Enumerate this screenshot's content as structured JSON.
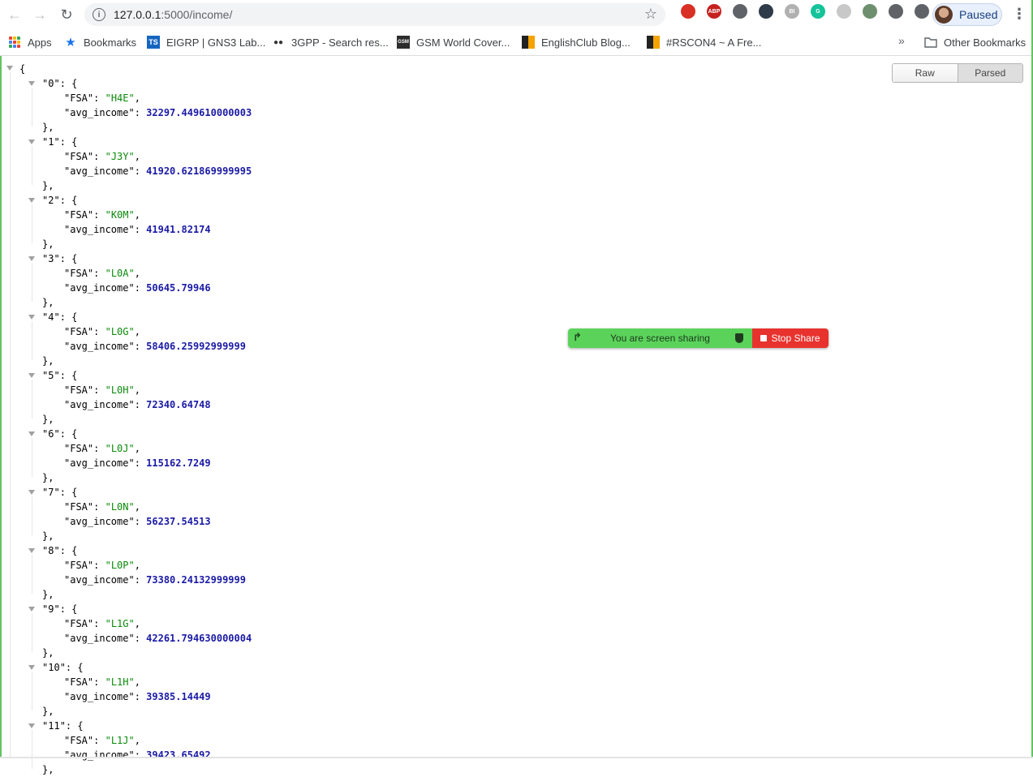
{
  "browser": {
    "url_host": "127.0.0.1",
    "url_path": ":5000/income/",
    "profile_label": "Paused",
    "nav_icons": [
      "back-arrow-icon",
      "forward-arrow-icon",
      "reload-icon"
    ],
    "extensions": [
      {
        "name": "adblock-icon",
        "text": "",
        "color": "#d93025"
      },
      {
        "name": "abp-icon",
        "text": "ABP",
        "color": "#c5221f"
      },
      {
        "name": "extension-circle-icon",
        "text": "",
        "color": "#5f6368"
      },
      {
        "name": "extension-dark-icon",
        "text": "",
        "color": "#2f3b48"
      },
      {
        "name": "extension-bi-icon",
        "text": "BI",
        "color": "#b0b0b0"
      },
      {
        "name": "grammarly-icon",
        "text": "G",
        "color": "#15c39a"
      },
      {
        "name": "extension-gray-icon",
        "text": "",
        "color": "#c8c8c8"
      },
      {
        "name": "eyedropper-icon",
        "text": "",
        "color": "#6e8f6e"
      },
      {
        "name": "extension-brackets-icon",
        "text": "",
        "color": "#5f6368"
      },
      {
        "name": "puzzle-icon",
        "text": "",
        "color": "#5f6368"
      }
    ]
  },
  "bookmarks": {
    "items": [
      {
        "label": "Apps"
      },
      {
        "label": "Bookmarks"
      },
      {
        "label": "EIGRP | GNS3 Lab..."
      },
      {
        "label": "3GPP - Search res..."
      },
      {
        "label": "GSM World Cover..."
      },
      {
        "label": "EnglishClub Blog..."
      },
      {
        "label": "#RSCON4 ~ A Fre..."
      }
    ],
    "overflow_label": "»",
    "other_label": "Other Bookmarks"
  },
  "viewer": {
    "raw_label": "Raw",
    "parsed_label": "Parsed",
    "root_open": "{",
    "records": [
      {
        "index": "0",
        "FSA": "H4E",
        "avg_income": "32297.449610000003"
      },
      {
        "index": "1",
        "FSA": "J3Y",
        "avg_income": "41920.621869999995"
      },
      {
        "index": "2",
        "FSA": "K0M",
        "avg_income": "41941.82174"
      },
      {
        "index": "3",
        "FSA": "L0A",
        "avg_income": "50645.79946"
      },
      {
        "index": "4",
        "FSA": "L0G",
        "avg_income": "58406.25992999999"
      },
      {
        "index": "5",
        "FSA": "L0H",
        "avg_income": "72340.64748"
      },
      {
        "index": "6",
        "FSA": "L0J",
        "avg_income": "115162.7249"
      },
      {
        "index": "7",
        "FSA": "L0N",
        "avg_income": "56237.54513"
      },
      {
        "index": "8",
        "FSA": "L0P",
        "avg_income": "73380.24132999999"
      },
      {
        "index": "9",
        "FSA": "L1G",
        "avg_income": "42261.794630000004"
      },
      {
        "index": "10",
        "FSA": "L1H",
        "avg_income": "39385.14449"
      },
      {
        "index": "11",
        "FSA": "L1J",
        "avg_income": "39423.65492"
      }
    ]
  },
  "screen_share": {
    "status_text": "You are screen sharing",
    "stop_label": "Stop Share",
    "colors": {
      "active": "#5bd35b",
      "stop": "#e8322e"
    }
  }
}
